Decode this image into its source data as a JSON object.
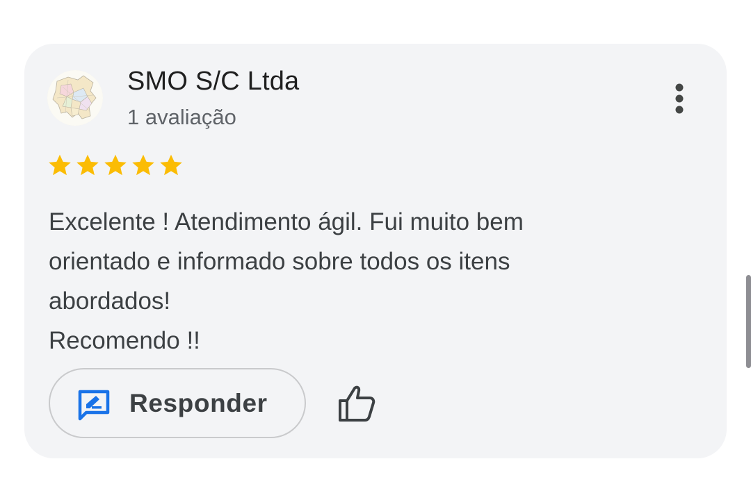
{
  "review": {
    "reviewer_name": "SMO S/C Ltda",
    "review_count": "1 avaliação",
    "rating": 5,
    "max_rating": 5,
    "text": "Excelente ! Atendimento ágil. Fui muito bem\norientado e informado sobre todos os itens\nabordados!\nRecomendo !!",
    "reply_label": "Responder"
  },
  "icons": {
    "avatar": "map-avatar-icon",
    "more": "more-vert-icon",
    "star": "star-icon",
    "reply": "reply-edit-icon",
    "like": "thumb-up-icon"
  },
  "colors": {
    "card_background": "#f3f4f6",
    "star": "#fbbc04",
    "reply_icon": "#1a73e8",
    "text_primary": "#1f1f1f",
    "text_secondary": "#5f6368"
  }
}
